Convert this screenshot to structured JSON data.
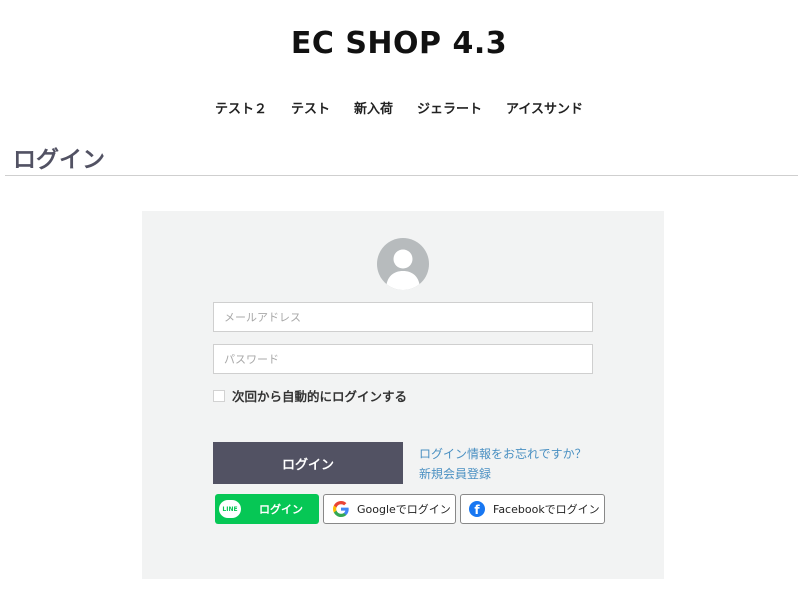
{
  "header": {
    "site_title": "EC SHOP 4.3",
    "nav": [
      "テスト２",
      "テスト",
      "新入荷",
      "ジェラート",
      "アイスサンド"
    ]
  },
  "page": {
    "title": "ログイン"
  },
  "login_form": {
    "email_placeholder": "メールアドレス",
    "password_placeholder": "パスワード",
    "remember_label": "次回から自動的にログインする",
    "submit_label": "ログイン",
    "forgot_link": "ログイン情報をお忘れですか？",
    "signup_link": "新規会員登録"
  },
  "social": {
    "line_logo_text": "LINE",
    "line_label": "ログイン",
    "google_label": "Googleでログイン",
    "facebook_label": "Facebookでログイン"
  },
  "colors": {
    "primary_button": "#525263",
    "panel_bg": "#f2f3f3",
    "link": "#4a90c2",
    "line_green": "#06c755",
    "facebook_blue": "#1877f2"
  }
}
